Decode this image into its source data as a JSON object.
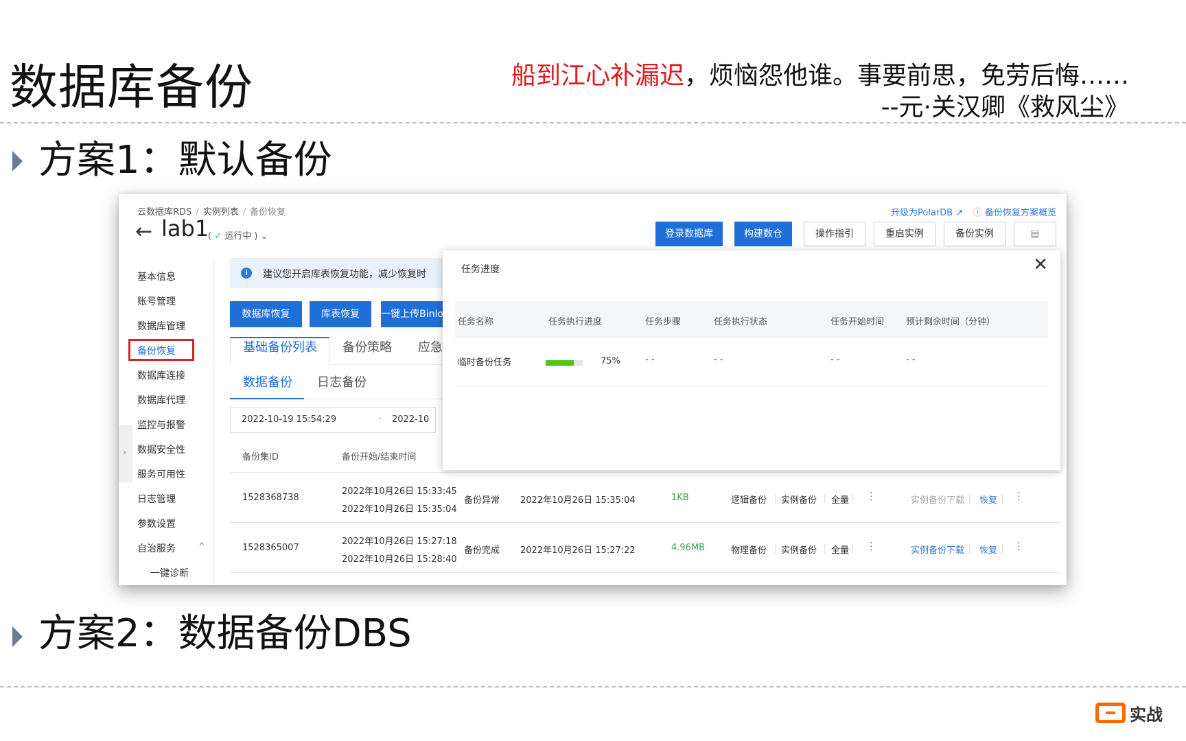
{
  "slide": {
    "title": "数据库备份",
    "quote_highlight": "船到江心补漏迟",
    "quote_rest": "，烦恼怨他谁。事要前思，免劳后悔……",
    "quote_source": "--元·关汉卿《救风尘》",
    "bullet1": "方案1：默认备份",
    "bullet2": "方案2：数据备份DBS",
    "logo_text": "实战"
  },
  "console": {
    "breadcrumb": [
      "云数据库RDS",
      "实例列表",
      "备份恢复"
    ],
    "instance_name": "lab1",
    "status": "运行中",
    "top_links": {
      "upgrade": "升级为PolarDB",
      "overview": "备份恢复方案概览"
    },
    "top_buttons": [
      "登录数据库",
      "构建数仓",
      "操作指引",
      "重启实例",
      "备份实例"
    ],
    "sidebar": [
      "基本信息",
      "账号管理",
      "数据库管理",
      "备份恢复",
      "数据库连接",
      "数据库代理",
      "监控与报警",
      "数据安全性",
      "服务可用性",
      "日志管理",
      "参数设置",
      "自治服务"
    ],
    "sidebar_sub": "一键诊断",
    "notice": "建议您开启库表恢复功能，减少恢复时",
    "action_buttons": [
      "数据库恢复",
      "库表恢复",
      "一键上传Binlog"
    ],
    "tabs": [
      "基础备份列表",
      "备份策略",
      "应急"
    ],
    "subtabs": [
      "数据备份",
      "日志备份"
    ],
    "date_start": "2022-10-19 15:54:29",
    "date_end": "2022-10",
    "columns": [
      "备份集ID",
      "备份开始/结束时间"
    ],
    "rows": [
      {
        "id": "1528368738",
        "start": "2022年10月26日 15:33:45",
        "end": "2022年10月26日 15:35:04",
        "state": "备份异常",
        "time": "2022年10月26日 15:35:04",
        "size": "1KB",
        "method": "逻辑备份",
        "type": "实例备份",
        "scope": "全量",
        "download": "实例备份下载",
        "restore": "恢复"
      },
      {
        "id": "1528365007",
        "start": "2022年10月26日 15:27:18",
        "end": "2022年10月26日 15:28:40",
        "state": "备份完成",
        "time": "2022年10月26日 15:27:22",
        "size": "4.96MB",
        "method": "物理备份",
        "type": "实例备份",
        "scope": "全量",
        "download": "实例备份下载",
        "restore": "恢复"
      }
    ],
    "modal": {
      "title": "任务进度",
      "headers": [
        "任务名称",
        "任务执行进度",
        "任务步骤",
        "任务执行状态",
        "任务开始时间",
        "预计剩余时间（分钟）"
      ],
      "task": {
        "name": "临时备份任务",
        "progress": 0.75,
        "progress_label": "75%",
        "step": "- -",
        "state": "- -",
        "start": "- -",
        "remaining": "- -"
      }
    }
  }
}
